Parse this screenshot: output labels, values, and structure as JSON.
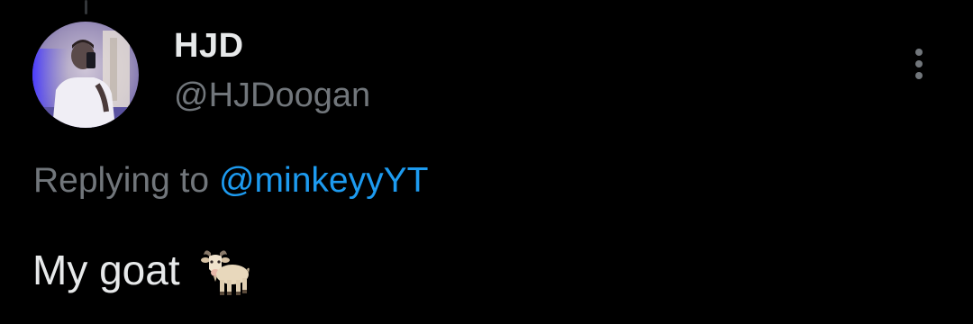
{
  "tweet": {
    "author": {
      "display_name": "HJD",
      "handle": "@HJDoogan",
      "avatar_icon": "profile-photo"
    },
    "more_options_icon": "vertical-ellipsis-icon",
    "reply_context": {
      "prefix": "Replying to ",
      "mention": "@minkeyyYT"
    },
    "text": "My goat",
    "emoji_icon": "goat-emoji"
  },
  "colors": {
    "background": "#000000",
    "primary_text": "#e7e9ea",
    "secondary_text": "#71767b",
    "link": "#1d9bf0"
  }
}
